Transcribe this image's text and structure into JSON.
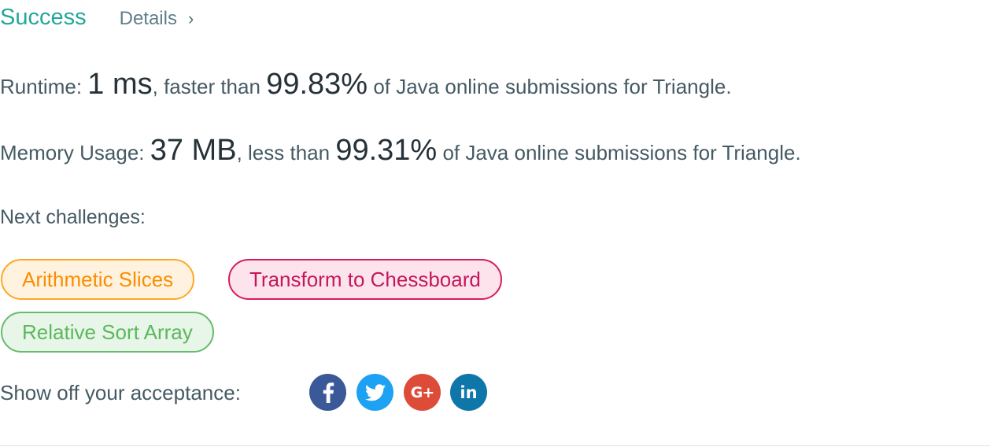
{
  "header": {
    "status": "Success",
    "details_label": "Details",
    "details_chevron": "›"
  },
  "runtime": {
    "label": "Runtime:",
    "value": "1 ms",
    "comparison": ", faster than",
    "percent": "99.83%",
    "suffix": "of Java online submissions for Triangle."
  },
  "memory": {
    "label": "Memory Usage:",
    "value": "37 MB",
    "comparison": ", less than",
    "percent": "99.31%",
    "suffix": "of Java online submissions for Triangle."
  },
  "next": {
    "label": "Next challenges:",
    "challenges": [
      {
        "title": "Arithmetic Slices",
        "difficulty_color": "#ffa726"
      },
      {
        "title": "Transform to Chessboard",
        "difficulty_color": "#d81b60"
      },
      {
        "title": "Relative Sort Array",
        "difficulty_color": "#66bb6a"
      }
    ]
  },
  "share": {
    "label": "Show off your acceptance:",
    "networks": [
      {
        "icon": "facebook-icon",
        "color": "#3b5998",
        "glyph": "f"
      },
      {
        "icon": "twitter-icon",
        "color": "#1da1f2"
      },
      {
        "icon": "google-plus-icon",
        "color": "#dd4b39",
        "glyph": "G+"
      },
      {
        "icon": "linkedin-icon",
        "color": "#0e76a8",
        "glyph": "in"
      }
    ]
  },
  "colors": {
    "success": "#26a69a",
    "text": "#455a64",
    "emphasis": "#263238"
  }
}
